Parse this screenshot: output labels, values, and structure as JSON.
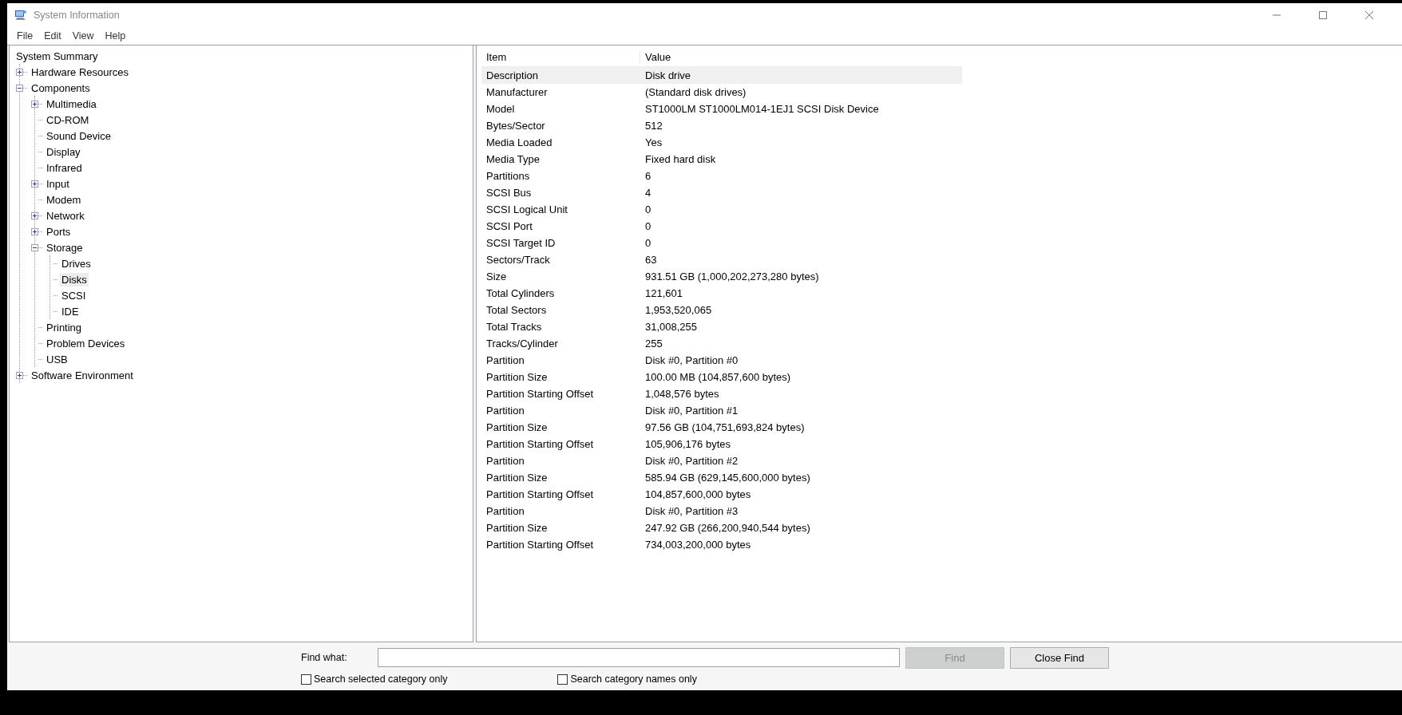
{
  "window": {
    "title": "System Information"
  },
  "menu": [
    "File",
    "Edit",
    "View",
    "Help"
  ],
  "tree": [
    {
      "label": "System Summary",
      "selected": false,
      "children": [
        {
          "label": "Hardware Resources",
          "selected": false,
          "expanded": false
        },
        {
          "label": "Components",
          "selected": false,
          "expanded": true,
          "children": [
            {
              "label": "Multimedia",
              "selected": false,
              "expanded": false
            },
            {
              "label": "CD-ROM",
              "selected": false
            },
            {
              "label": "Sound Device",
              "selected": false
            },
            {
              "label": "Display",
              "selected": false
            },
            {
              "label": "Infrared",
              "selected": false
            },
            {
              "label": "Input",
              "selected": false,
              "expanded": false
            },
            {
              "label": "Modem",
              "selected": false
            },
            {
              "label": "Network",
              "selected": false,
              "expanded": false
            },
            {
              "label": "Ports",
              "selected": false,
              "expanded": false
            },
            {
              "label": "Storage",
              "selected": false,
              "expanded": true,
              "children": [
                {
                  "label": "Drives",
                  "selected": false
                },
                {
                  "label": "Disks",
                  "selected": true
                },
                {
                  "label": "SCSI",
                  "selected": false
                },
                {
                  "label": "IDE",
                  "selected": false
                }
              ]
            },
            {
              "label": "Printing",
              "selected": false
            },
            {
              "label": "Problem Devices",
              "selected": false
            },
            {
              "label": "USB",
              "selected": false
            }
          ]
        },
        {
          "label": "Software Environment",
          "selected": false,
          "expanded": false
        }
      ]
    }
  ],
  "table": {
    "columns": [
      "Item",
      "Value"
    ],
    "rows": [
      {
        "item": "Description",
        "value": "Disk drive",
        "selected": true
      },
      {
        "item": "Manufacturer",
        "value": "(Standard disk drives)",
        "selected": false
      },
      {
        "item": "Model",
        "value": "ST1000LM ST1000LM014-1EJ1 SCSI Disk Device",
        "selected": false
      },
      {
        "item": "Bytes/Sector",
        "value": "512",
        "selected": false
      },
      {
        "item": "Media Loaded",
        "value": "Yes",
        "selected": false
      },
      {
        "item": "Media Type",
        "value": "Fixed hard disk",
        "selected": false
      },
      {
        "item": "Partitions",
        "value": "6",
        "selected": false
      },
      {
        "item": "SCSI Bus",
        "value": "4",
        "selected": false
      },
      {
        "item": "SCSI Logical Unit",
        "value": "0",
        "selected": false
      },
      {
        "item": "SCSI Port",
        "value": "0",
        "selected": false
      },
      {
        "item": "SCSI Target ID",
        "value": "0",
        "selected": false
      },
      {
        "item": "Sectors/Track",
        "value": "63",
        "selected": false
      },
      {
        "item": "Size",
        "value": "931.51 GB (1,000,202,273,280 bytes)",
        "selected": false
      },
      {
        "item": "Total Cylinders",
        "value": "121,601",
        "selected": false
      },
      {
        "item": "Total Sectors",
        "value": "1,953,520,065",
        "selected": false
      },
      {
        "item": "Total Tracks",
        "value": "31,008,255",
        "selected": false
      },
      {
        "item": "Tracks/Cylinder",
        "value": "255",
        "selected": false
      },
      {
        "item": "Partition",
        "value": "Disk #0, Partition #0",
        "selected": false
      },
      {
        "item": "Partition Size",
        "value": "100.00 MB (104,857,600 bytes)",
        "selected": false
      },
      {
        "item": "Partition Starting Offset",
        "value": "1,048,576 bytes",
        "selected": false
      },
      {
        "item": "Partition",
        "value": "Disk #0, Partition #1",
        "selected": false
      },
      {
        "item": "Partition Size",
        "value": "97.56 GB (104,751,693,824 bytes)",
        "selected": false
      },
      {
        "item": "Partition Starting Offset",
        "value": "105,906,176 bytes",
        "selected": false
      },
      {
        "item": "Partition",
        "value": "Disk #0, Partition #2",
        "selected": false
      },
      {
        "item": "Partition Size",
        "value": "585.94 GB (629,145,600,000 bytes)",
        "selected": false
      },
      {
        "item": "Partition Starting Offset",
        "value": "104,857,600,000 bytes",
        "selected": false
      },
      {
        "item": "Partition",
        "value": "Disk #0, Partition #3",
        "selected": false
      },
      {
        "item": "Partition Size",
        "value": "247.92 GB (266,200,940,544 bytes)",
        "selected": false
      },
      {
        "item": "Partition Starting Offset",
        "value": "734,003,200,000 bytes",
        "selected": false
      }
    ]
  },
  "find": {
    "label": "Find what:",
    "find_button": {
      "label": "Find",
      "disabled": true
    },
    "close_button": {
      "label": "Close Find",
      "disabled": false
    },
    "options": [
      {
        "label": "Search selected category only",
        "checked": false
      },
      {
        "label": "Search category names only",
        "checked": false
      }
    ]
  }
}
